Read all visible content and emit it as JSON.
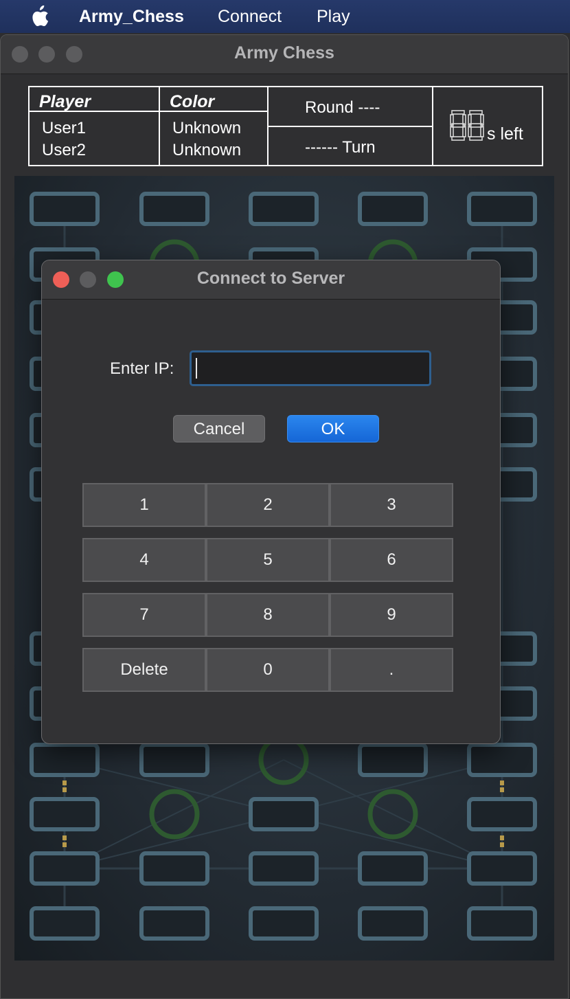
{
  "menubar": {
    "apple_icon": "apple-logo-icon",
    "app_name": "Army_Chess",
    "items": [
      "Connect",
      "Play"
    ]
  },
  "window": {
    "title": "Army Chess"
  },
  "info": {
    "headers": {
      "player": "Player",
      "color": "Color"
    },
    "players": [
      {
        "name": "User1",
        "color": "Unknown"
      },
      {
        "name": "User2",
        "color": "Unknown"
      }
    ],
    "round": "Round ----",
    "turn": "------ Turn",
    "timer_digits": "88",
    "timer_suffix": "s left"
  },
  "dialog": {
    "title": "Connect to Server",
    "ip_label": "Enter IP:",
    "ip_value": "",
    "cancel_label": "Cancel",
    "ok_label": "OK",
    "keypad": [
      "1",
      "2",
      "3",
      "4",
      "5",
      "6",
      "7",
      "8",
      "9",
      "Delete",
      "0",
      "."
    ]
  },
  "colors": {
    "menubar": "#22355f",
    "ok_button": "#1a6fe0",
    "close_button": "#ee5f57",
    "zoom_button": "#3fc34e",
    "board_post": "#4a6878",
    "camp_ring": "#2e5a30"
  }
}
